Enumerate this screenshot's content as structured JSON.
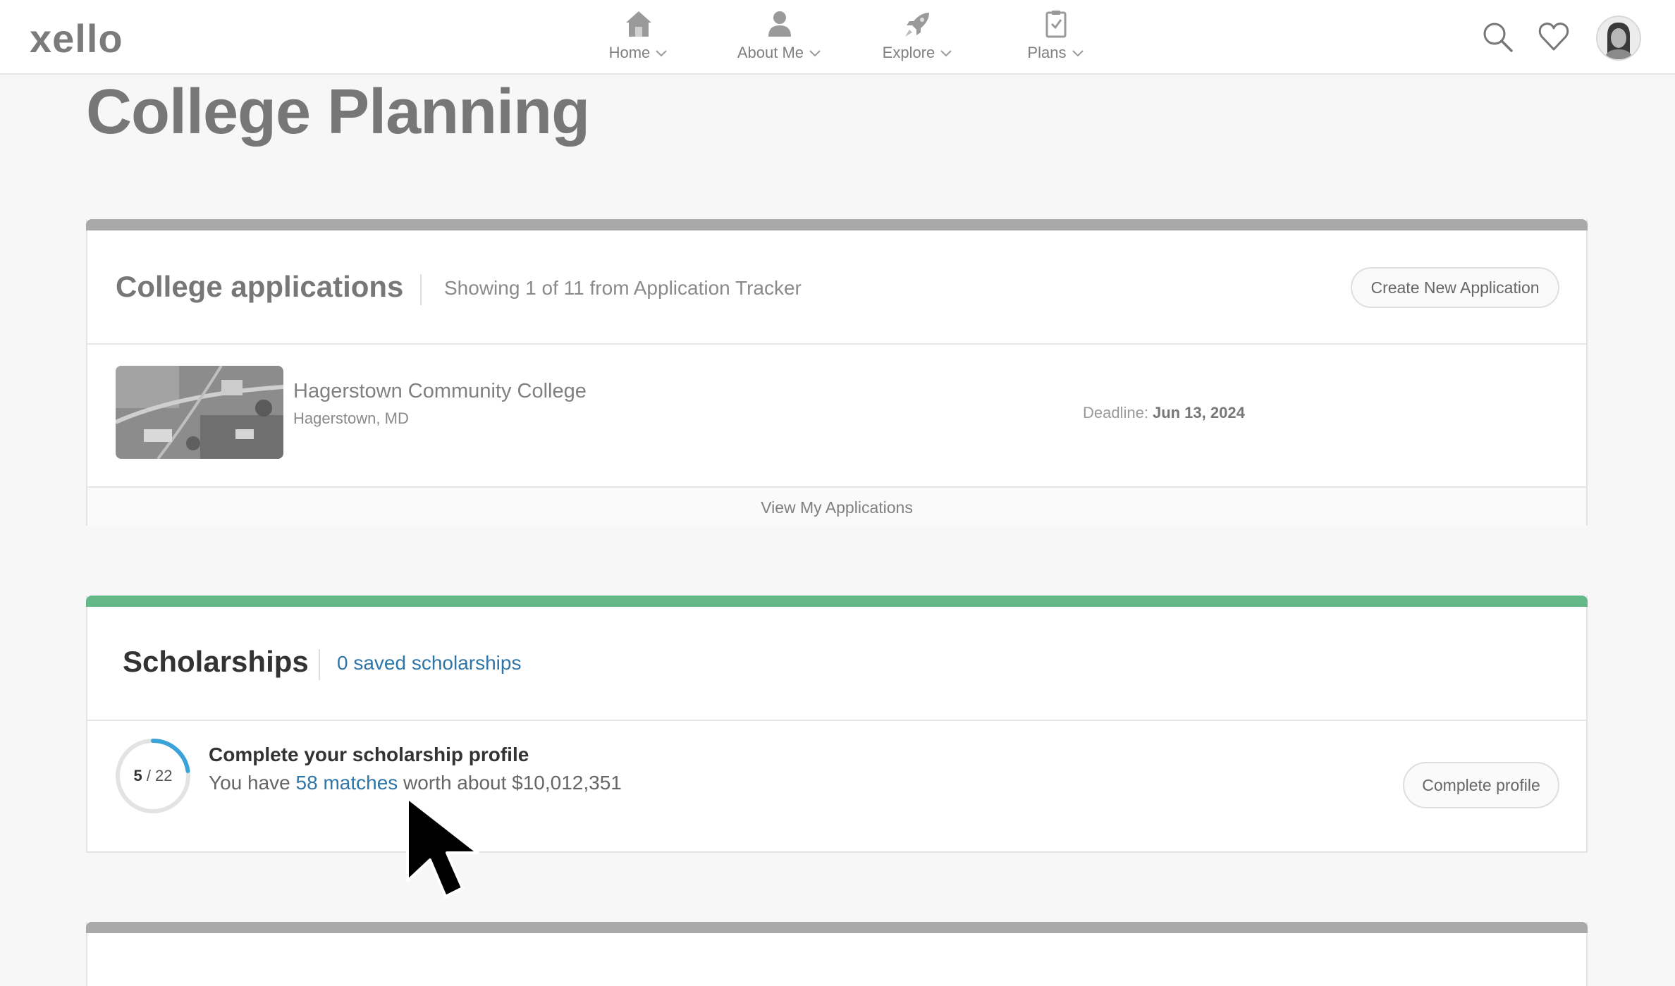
{
  "header": {
    "logo": "xello",
    "nav": [
      {
        "label": "Home",
        "icon": "home-icon"
      },
      {
        "label": "About Me",
        "icon": "person-icon"
      },
      {
        "label": "Explore",
        "icon": "rocket-icon"
      },
      {
        "label": "Plans",
        "icon": "clipboard-icon"
      }
    ],
    "icons": [
      "search-icon",
      "heart-icon",
      "avatar"
    ]
  },
  "page": {
    "title": "College Planning"
  },
  "applications": {
    "title": "College applications",
    "subtitle": "Showing 1 of 11 from Application Tracker",
    "create_button": "Create New Application",
    "item": {
      "name": "Hagerstown Community College",
      "location": "Hagerstown, MD",
      "deadline_label": "Deadline:",
      "deadline_value": "Jun 13, 2024"
    },
    "view_link": "View My Applications"
  },
  "scholarships": {
    "title": "Scholarships",
    "saved_link": "0 saved scholarships",
    "progress": {
      "completed": "5",
      "separator": " / ",
      "total": "22",
      "fraction": 0.227
    },
    "profile_title": "Complete your scholarship profile",
    "desc_prefix": "You have ",
    "matches_link": "58 matches",
    "desc_suffix": " worth about $10,012,351",
    "complete_button": "Complete profile"
  },
  "colors": {
    "grey_bar": "#a9a9a9",
    "green_bar": "#64b888",
    "link": "#2f76a8",
    "progress_ring": "#3aa3d9"
  }
}
